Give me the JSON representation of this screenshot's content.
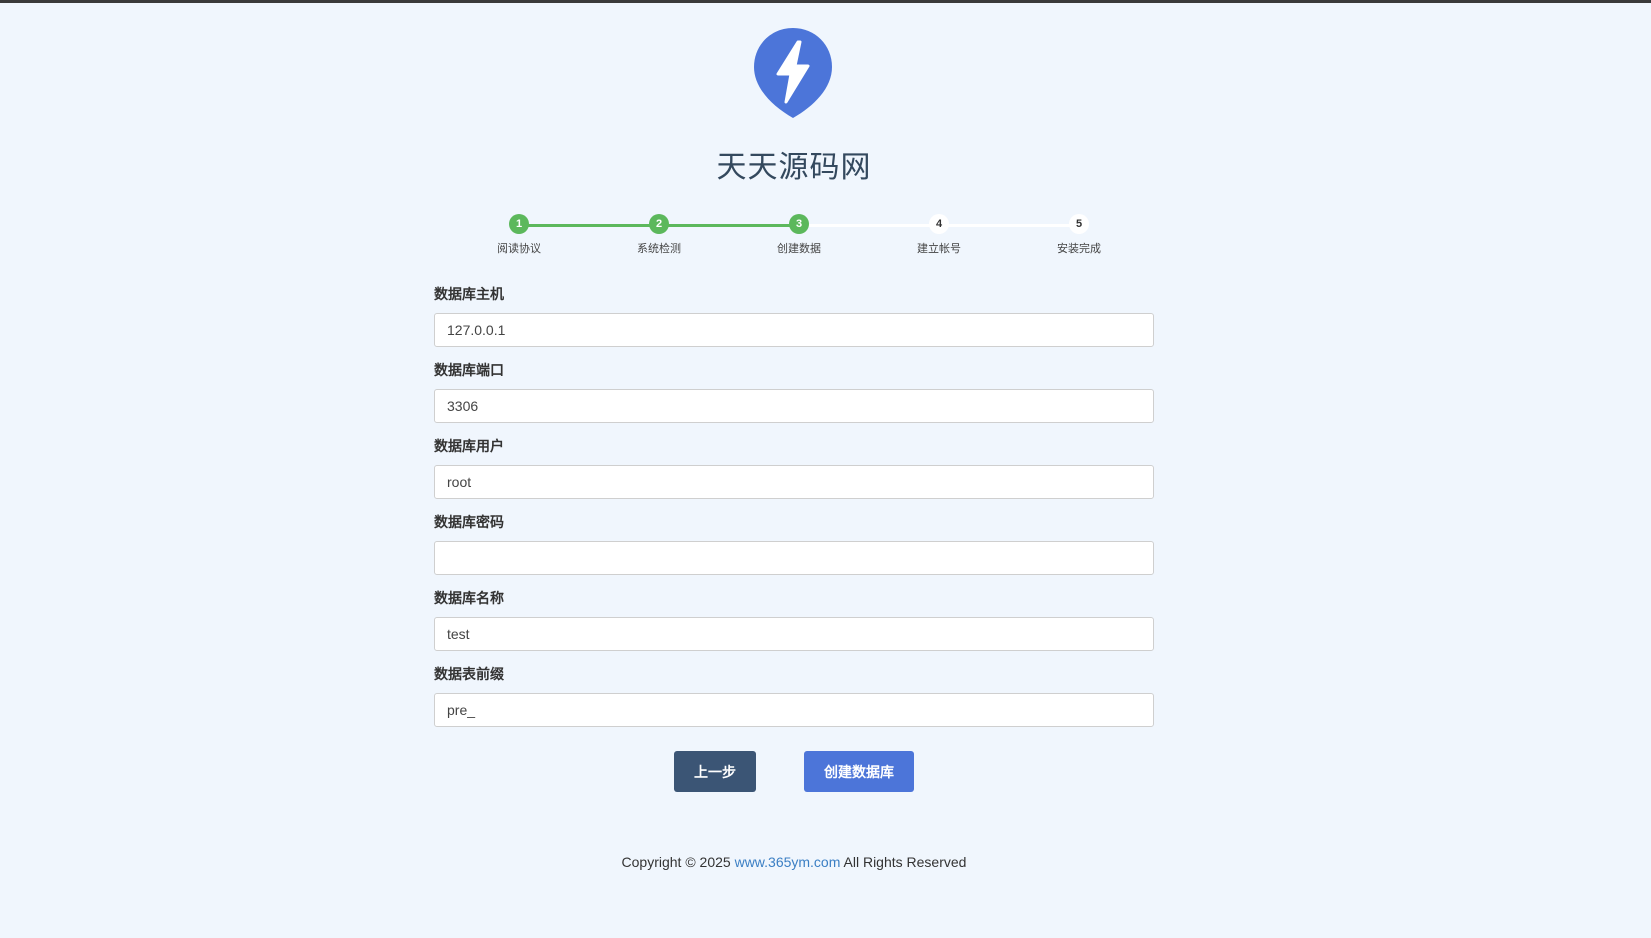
{
  "site": {
    "title": "天天源码网",
    "logo_icon": "lightning-bolt-icon",
    "logo_color": "#4c75d9"
  },
  "steps": [
    {
      "number": "1",
      "label": "阅读协议",
      "status": "done"
    },
    {
      "number": "2",
      "label": "系统检测",
      "status": "done"
    },
    {
      "number": "3",
      "label": "创建数据",
      "status": "done"
    },
    {
      "number": "4",
      "label": "建立帐号",
      "status": "todo"
    },
    {
      "number": "5",
      "label": "安装完成",
      "status": "todo"
    }
  ],
  "form": {
    "host": {
      "label": "数据库主机",
      "value": "127.0.0.1"
    },
    "port": {
      "label": "数据库端口",
      "value": "3306"
    },
    "user": {
      "label": "数据库用户",
      "value": "root"
    },
    "password": {
      "label": "数据库密码",
      "value": ""
    },
    "name": {
      "label": "数据库名称",
      "value": "test"
    },
    "prefix": {
      "label": "数据表前缀",
      "value": "pre_"
    }
  },
  "buttons": {
    "prev_label": "上一步",
    "create_label": "创建数据库"
  },
  "footer": {
    "prefix": "Copyright © 2025",
    "link_text": "www.365ym.com",
    "suffix": "All Rights Reserved"
  },
  "colors": {
    "done": "#5cb85c",
    "prev_button": "#3b5575",
    "primary_button": "#4c75d9",
    "background": "#f0f6fd"
  }
}
